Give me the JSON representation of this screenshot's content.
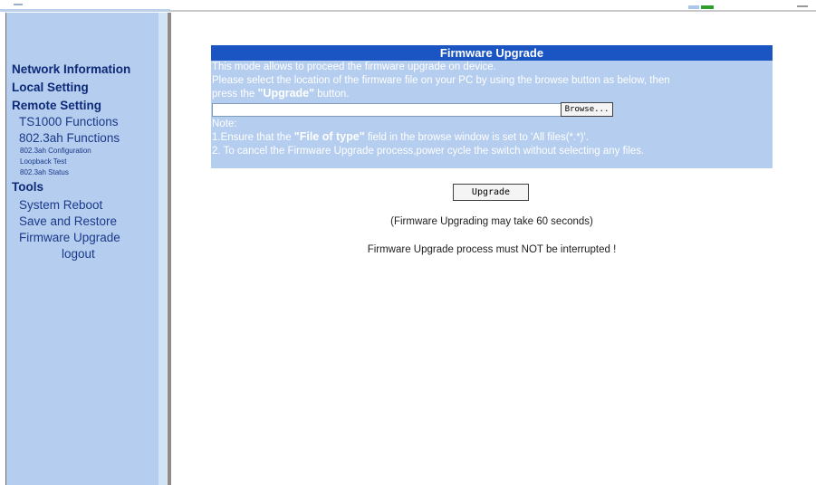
{
  "sidebar": {
    "network_information": "Network Information",
    "local_setting": "Local Setting",
    "remote_setting": "Remote Setting",
    "ts1000_functions": "TS1000 Functions",
    "functions_8023ah": "802.3ah Functions",
    "configuration_8023ah": "802.3ah Configuration",
    "loopback_test": "Loopback Test",
    "status_8023ah": "802.3ah Status",
    "tools": "Tools",
    "system_reboot": "System Reboot",
    "save_and_restore": "Save and Restore",
    "firmware_upgrade": "Firmware Upgrade",
    "logout": "logout"
  },
  "panel": {
    "title": "Firmware Upgrade",
    "line1": "This mode allows to proceed the firmware upgrade on device.",
    "line2": "Please select the location of the firmware file on your PC by using the browse button as below, then",
    "line3_prefix": "press the ",
    "line3_bold": "\"Upgrade\"",
    "line3_suffix": " button.",
    "file_value": "",
    "browse_label": "Browse...",
    "note_label": "Note:",
    "note1_prefix": "1.Ensure that the ",
    "note1_bold": "\"File of type\"",
    "note1_suffix": " field in the browse window is set to 'All files(*.*)'.",
    "note2": "2. To cancel the Firmware Upgrade process,power cycle the switch without selecting any files."
  },
  "actions": {
    "upgrade_label": "Upgrade"
  },
  "messages": {
    "time_notice": "(Firmware Upgrading may take 60 seconds)",
    "warning": "Firmware Upgrade process must NOT be interrupted !"
  },
  "colors": {
    "sidebar_bg": "#b5cdee",
    "panel_header": "#1b55c4",
    "nav_text": "#0d2a78"
  }
}
